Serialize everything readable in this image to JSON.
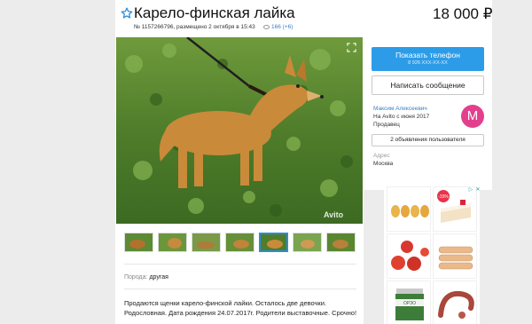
{
  "listing": {
    "title": "Карело-финская лайка",
    "price": "18 000 ₽",
    "meta": "№ 1157266796, размещено 2 октября в 15:43",
    "views": "166 (+6)",
    "watermark": "Avito"
  },
  "details": {
    "breed_label": "Порода:",
    "breed_value": "другая",
    "description": "Продаются щенки карело-финской лайки. Осталось две девочки. Родословная. Дата рождения 24.07.2017г. Родители выставочные. Срочно!"
  },
  "contact": {
    "phone_button": "Показать телефон",
    "phone_masked": "8 926 XXX-XX-XX",
    "message_button": "Написать сообщение"
  },
  "seller": {
    "name": "Максим Алексеевич",
    "since": "На Avito с июня 2017",
    "type": "Продавец",
    "avatar_letter": "М",
    "ads_button": "2 объявления пользователя",
    "address_label": "Адрес",
    "address_value": "Москва"
  },
  "ad": {
    "badge": "-33%",
    "jar_label": "ОРЗО"
  },
  "colors": {
    "accent_blue": "#2c9ce8",
    "link_blue": "#3d7fc1",
    "avatar_pink": "#e33f8c"
  },
  "icons": {
    "favorite": "star-outline-icon",
    "views": "eye-icon",
    "expand": "expand-icon"
  }
}
